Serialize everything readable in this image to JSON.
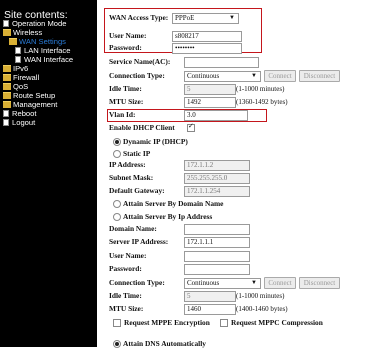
{
  "sidebar": {
    "title": "Site contents:",
    "items": [
      {
        "label": "Operation Mode",
        "icon": "page-icon"
      },
      {
        "label": "Wireless",
        "icon": "folder-icon"
      },
      {
        "label": "WAN Settings",
        "icon": "folder-icon"
      },
      {
        "label": "LAN Interface",
        "icon": "page-icon"
      },
      {
        "label": "WAN Interface",
        "icon": "page-icon"
      },
      {
        "label": "IPv6",
        "icon": "folder-icon"
      },
      {
        "label": "Firewall",
        "icon": "folder-icon"
      },
      {
        "label": "QoS",
        "icon": "folder-icon"
      },
      {
        "label": "Route Setup",
        "icon": "folder-icon"
      },
      {
        "label": "Management",
        "icon": "folder-icon"
      },
      {
        "label": "Reboot",
        "icon": "page-icon"
      },
      {
        "label": "Logout",
        "icon": "page-icon"
      }
    ]
  },
  "wan": {
    "access_type_label": "WAN Access Type:",
    "access_type_value": "PPPoE",
    "user_name_label": "User Name:",
    "user_name_value": "s808217",
    "password_label": "Password:",
    "password_value": "••••••••",
    "service_name_label": "Service Name(AC):",
    "service_name_value": "",
    "connection_type_label": "Connection Type:",
    "connection_type_value": "Continuous",
    "connect_button": "Connect",
    "disconnect_button": "Disconnect",
    "idle_time_label": "Idle Time:",
    "idle_time_value": "5",
    "idle_time_note": "(1-1000 minutes)",
    "mtu_label": "MTU Size:",
    "mtu_value": "1492",
    "mtu_note": "(1360-1492 bytes)",
    "vlan_label": "Vlan Id:",
    "vlan_value": "3.0",
    "dhcp_label": "Enable DHCP Client",
    "dynamic_ip_label": "Dynamic IP (DHCP)",
    "static_ip_label": "Static IP",
    "ip_address_label": "IP Address:",
    "ip_address_value": "172.1.1.2",
    "subnet_label": "Subnet Mask:",
    "subnet_value": "255.255.255.0",
    "gateway_label": "Default Gateway:",
    "gateway_value": "172.1.1.254",
    "attain_domain_label": "Attain Server By Domain Name",
    "attain_ip_label": "Attain Server By Ip Address",
    "domain_name_label": "Domain Name:",
    "domain_name_value": "",
    "server_ip_label": "Server IP Address:",
    "server_ip_value": "172.1.1.1",
    "user_name2_label": "User Name:",
    "password2_label": "Password:",
    "connection_type2_label": "Connection Type:",
    "connection_type2_value": "Continuous",
    "connect2_button": "Connect",
    "disconnect2_button": "Disconnect",
    "idle_time2_label": "Idle Time:",
    "idle_time2_value": "5",
    "idle_time2_note": "(1-1000 minutes)",
    "mtu2_label": "MTU Size:",
    "mtu2_value": "1460",
    "mtu2_note": "(1400-1460 bytes)",
    "mppe_label": "Request MPPE Encryption",
    "mppc_label": "Request MPPC Compression",
    "attain_dns_label": "Attain DNS Automatically"
  },
  "colors": {
    "highlight": "#c4161c",
    "sidebar_bg": "#000000",
    "folder": "#d9b035",
    "active_link": "#2a7bd6"
  }
}
